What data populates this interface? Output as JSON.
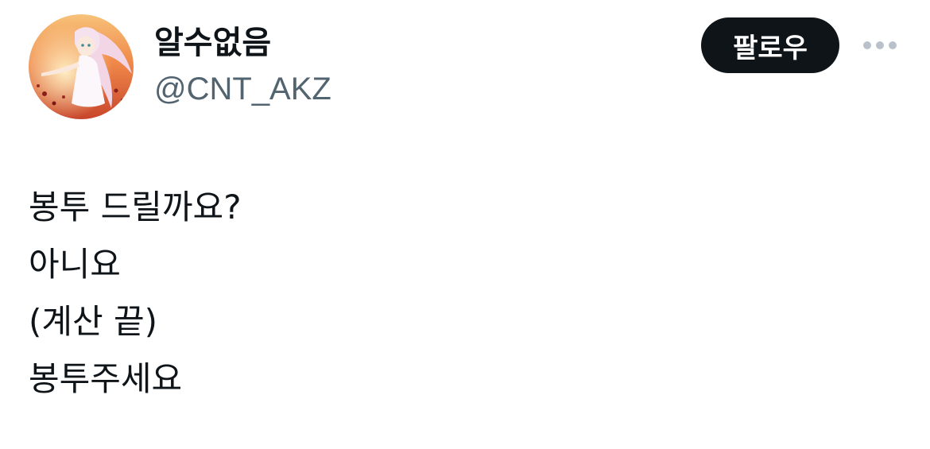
{
  "author": {
    "display_name": "알수없음",
    "handle": "@CNT_AKZ",
    "avatar": "anime-girl-sunset-avatar"
  },
  "actions": {
    "follow_label": "팔로우",
    "more_icon": "more-horizontal-icon"
  },
  "tweet": {
    "lines": [
      "봉투 드릴까요?",
      "아니요",
      "(계산 끝)",
      "봉투주세요"
    ]
  },
  "colors": {
    "text_primary": "#0f1419",
    "text_secondary": "#536471",
    "follow_button_bg": "#0f1419",
    "follow_button_text": "#ffffff",
    "more_icon": "#b9c2cc"
  }
}
